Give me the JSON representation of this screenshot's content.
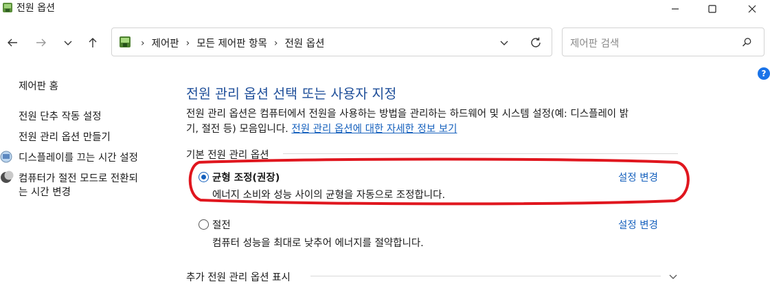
{
  "window": {
    "title": "전원 옵션"
  },
  "address_bar": {
    "breadcrumbs": [
      "제어판",
      "모든 제어판 항목",
      "전원 옵션"
    ]
  },
  "search": {
    "placeholder": "제어판 검색"
  },
  "sidebar": {
    "home": "제어판 홈",
    "items": [
      {
        "label": "전원 단추 작동 설정"
      },
      {
        "label": "전원 관리 옵션 만들기"
      },
      {
        "label": "디스플레이를 끄는 시간 설정",
        "icon": "display-icon"
      },
      {
        "label_line1": "컴퓨터가 절전 모드로 전환되",
        "label_line2": "는 시간 변경",
        "icon": "moon-icon"
      }
    ]
  },
  "main": {
    "heading": "전원 관리 옵션 선택 또는 사용자 지정",
    "description_line1": "전원 관리 옵션은 컴퓨터에서 전원을 사용하는 방법을 관리하는 하드웨어 및 시스템 설정(예: 디스플레이 밝",
    "description_line2": "기, 절전 등) 모음입니다.",
    "description_link": "전원 관리 옵션에 대한 자세한 정보 보기",
    "basic_section_label": "기본 전원 관리 옵션",
    "plans": [
      {
        "name": "균형 조정(권장)",
        "description": "에너지 소비와 성능 사이의 균형을 자동으로 조정합니다.",
        "change": "설정 변경",
        "selected": true
      },
      {
        "name": "절전",
        "description": "컴퓨터 성능을 최대로 낮추어 에너지를 절약합니다.",
        "change": "설정 변경",
        "selected": false
      }
    ],
    "additional_section_label": "추가 전원 관리 옵션 표시"
  },
  "colors": {
    "accent": "#1560bd",
    "heading": "#1e4e99",
    "highlight_ring": "#e0161e"
  }
}
